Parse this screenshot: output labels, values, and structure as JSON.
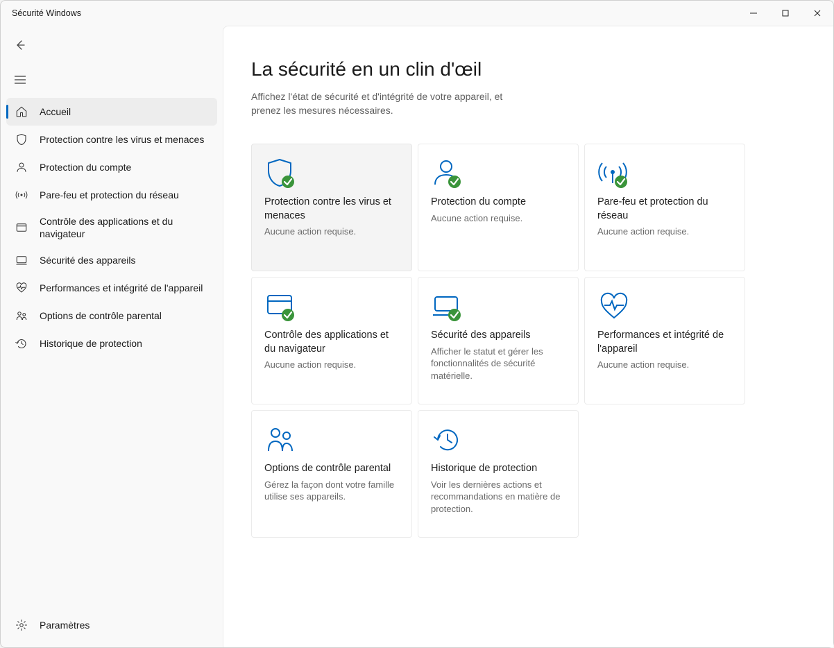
{
  "window": {
    "title": "Sécurité Windows"
  },
  "sidebar": {
    "items": [
      {
        "icon": "home-icon",
        "label": "Accueil"
      },
      {
        "icon": "shield-icon",
        "label": "Protection contre les virus et menaces"
      },
      {
        "icon": "account-icon",
        "label": "Protection du compte"
      },
      {
        "icon": "network-icon",
        "label": "Pare-feu et protection du réseau"
      },
      {
        "icon": "appcontrol-icon",
        "label": "Contrôle des applications et du navigateur"
      },
      {
        "icon": "device-icon",
        "label": "Sécurité des appareils"
      },
      {
        "icon": "health-icon",
        "label": "Performances et intégrité de l'appareil"
      },
      {
        "icon": "family-icon",
        "label": "Options de contrôle parental"
      },
      {
        "icon": "history-icon",
        "label": "Historique de protection"
      }
    ],
    "settings_label": "Paramètres"
  },
  "main": {
    "title": "La sécurité en un clin d'œil",
    "subtitle": "Affichez l'état de sécurité et d'intégrité de votre appareil, et prenez les mesures nécessaires.",
    "cards": [
      {
        "icon": "shield-icon",
        "badge": true,
        "title": "Protection contre les virus et menaces",
        "desc": "Aucune action requise."
      },
      {
        "icon": "account-icon",
        "badge": true,
        "title": "Protection du compte",
        "desc": "Aucune action requise."
      },
      {
        "icon": "network-icon",
        "badge": true,
        "title": "Pare-feu et protection du réseau",
        "desc": "Aucune action requise."
      },
      {
        "icon": "appcontrol-icon",
        "badge": true,
        "title": "Contrôle des applications et du navigateur",
        "desc": "Aucune action requise."
      },
      {
        "icon": "device-icon",
        "badge": true,
        "title": "Sécurité des appareils",
        "desc": "Afficher le statut et gérer les fonctionnalités de sécurité matérielle."
      },
      {
        "icon": "health-icon",
        "badge": false,
        "title": "Performances et intégrité de l'appareil",
        "desc": "Aucune action requise."
      },
      {
        "icon": "family-icon",
        "badge": false,
        "title": "Options de contrôle parental",
        "desc": "Gérez la façon dont votre famille utilise ses appareils."
      },
      {
        "icon": "history-icon",
        "badge": false,
        "title": "Historique de protection",
        "desc": "Voir les dernières actions et recommandations en matière de protection."
      }
    ]
  }
}
